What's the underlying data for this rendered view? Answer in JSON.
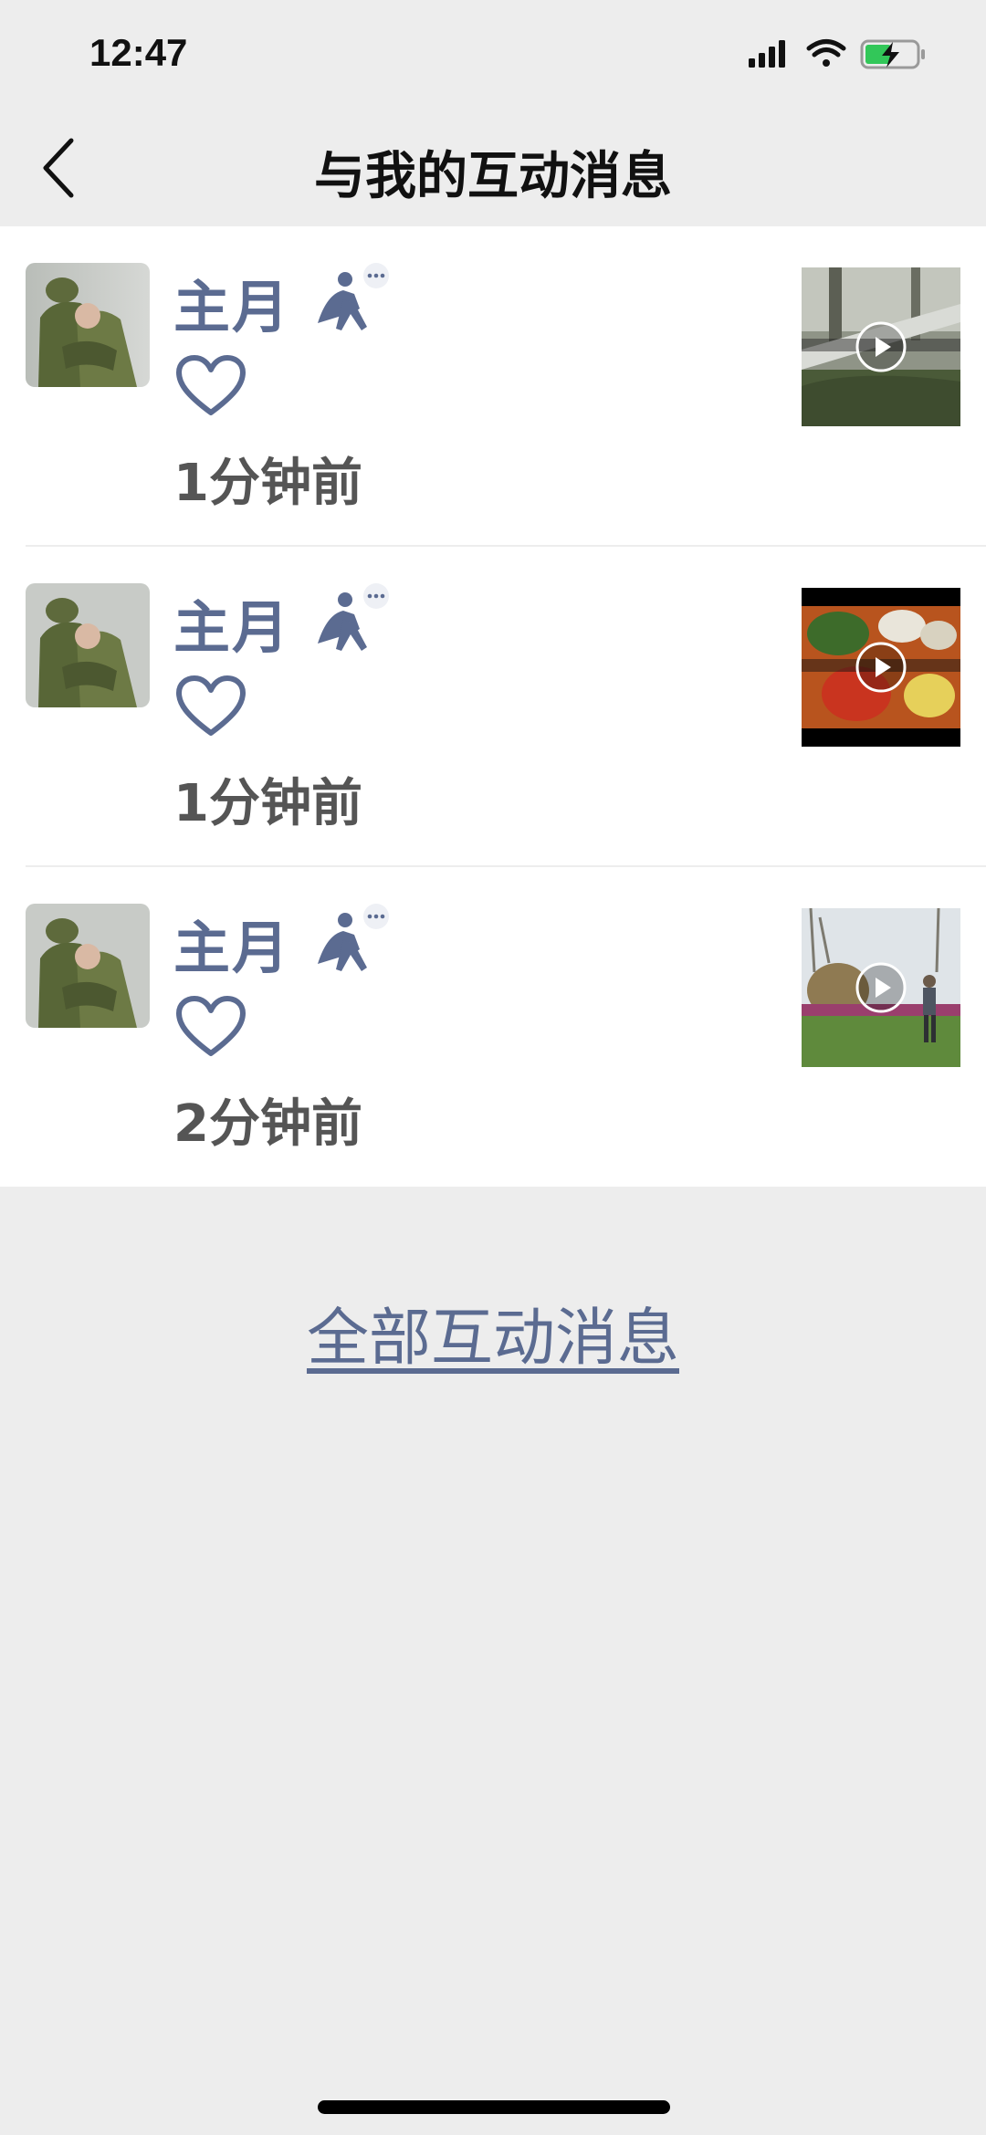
{
  "status_bar": {
    "time": "12:47"
  },
  "nav": {
    "title": "与我的互动消息",
    "back_icon": "chevron-left-icon"
  },
  "messages": [
    {
      "name": "主月",
      "time": "1分钟前",
      "liked": true,
      "thumbnail": "video-thumbnail-garden-fence"
    },
    {
      "name": "主月",
      "time": "1分钟前",
      "liked": true,
      "thumbnail": "video-thumbnail-food-bowls"
    },
    {
      "name": "主月",
      "time": "2分钟前",
      "liked": true,
      "thumbnail": "video-thumbnail-park-person"
    }
  ],
  "footer": {
    "all_messages_label": "全部互动消息"
  },
  "colors": {
    "accent": "#5b6b91",
    "background": "#ededed",
    "card": "#ffffff"
  }
}
